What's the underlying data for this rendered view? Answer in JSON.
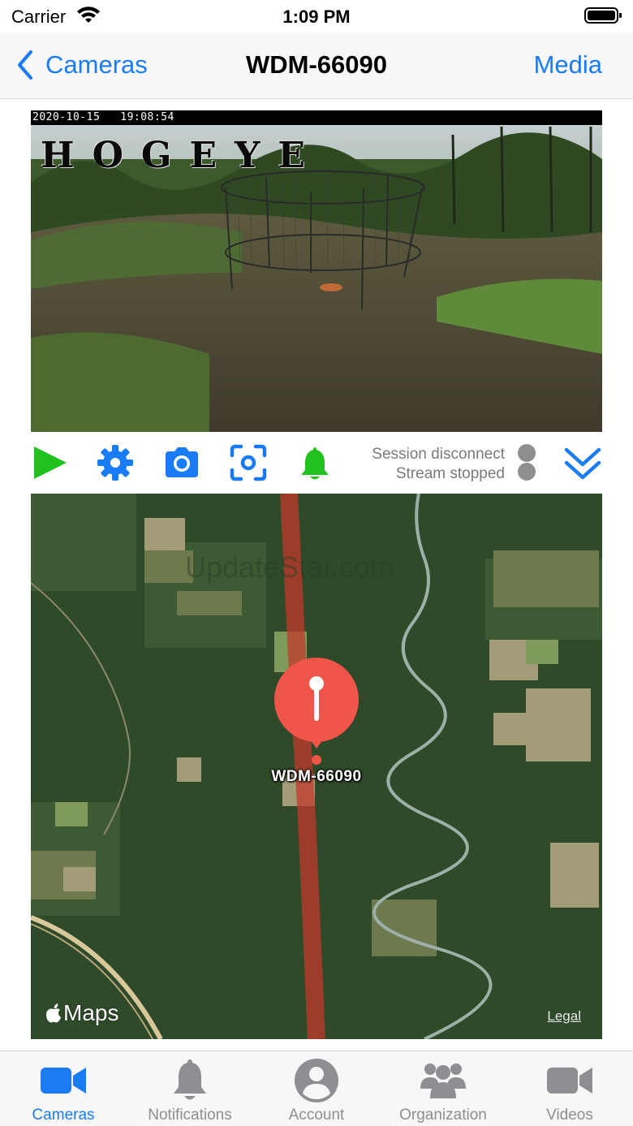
{
  "status_bar": {
    "carrier": "Carrier",
    "time": "1:09 PM"
  },
  "nav": {
    "back_label": "Cameras",
    "title": "WDM-66090",
    "media_label": "Media"
  },
  "camera": {
    "timestamp": "2020-10-15   19:08:54",
    "logo_text": "HOGEYE"
  },
  "controls": {
    "icons": [
      "play-icon",
      "gear-icon",
      "camera-icon",
      "focus-icon",
      "bell-icon",
      "double-chevron-down-icon"
    ],
    "session_status": "Session disconnect",
    "stream_status": "Stream stopped"
  },
  "map": {
    "watermark": "UpdateStar.com",
    "pin_label": "WDM-66090",
    "maps_label": "Maps",
    "legal_label": "Legal"
  },
  "tabs": [
    {
      "label": "Cameras",
      "icon": "video-camera-icon",
      "active": true
    },
    {
      "label": "Notifications",
      "icon": "bell-icon",
      "active": false
    },
    {
      "label": "Account",
      "icon": "person-circle-icon",
      "active": false
    },
    {
      "label": "Organization",
      "icon": "people-group-icon",
      "active": false
    },
    {
      "label": "Videos",
      "icon": "video-camera-icon",
      "active": false
    }
  ],
  "colors": {
    "accent": "#1a7cf5",
    "play": "#22c21e",
    "bell": "#22c21e",
    "pin": "#ef5548",
    "inactive": "#8e8e93"
  }
}
